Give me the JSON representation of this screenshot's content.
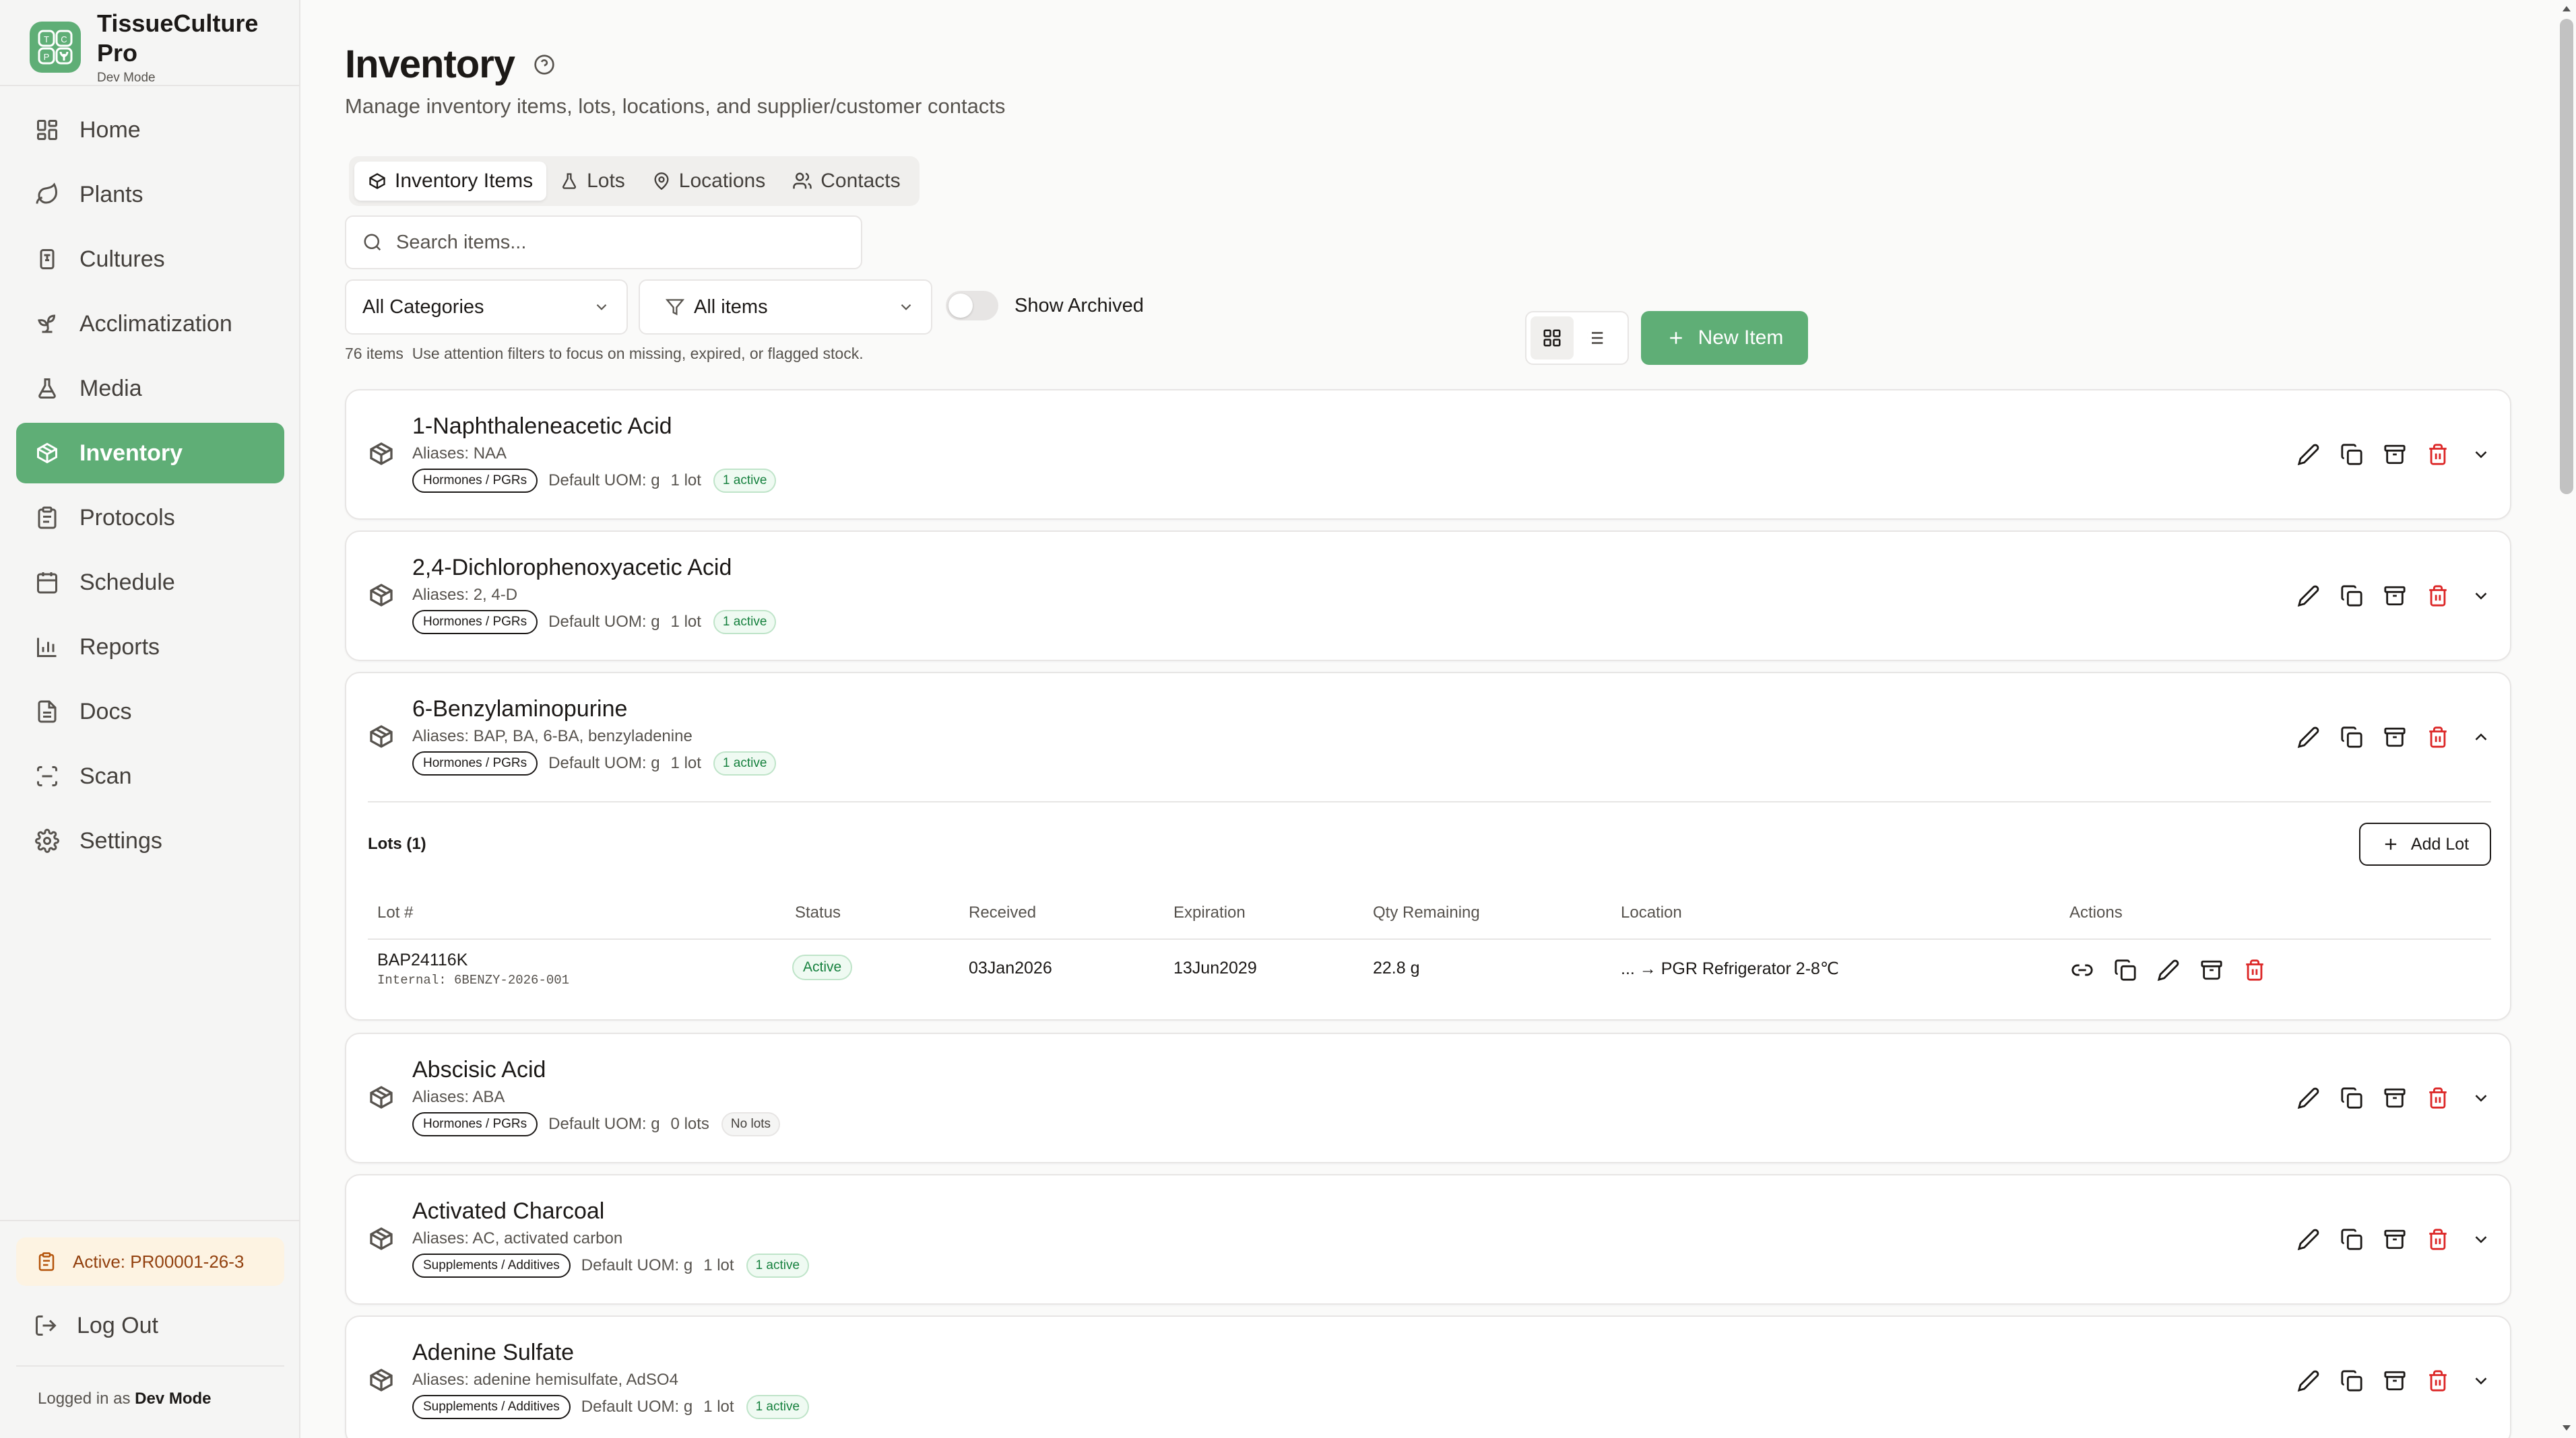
{
  "brand": {
    "name": "TissueCulture Pro",
    "mode": "Dev Mode"
  },
  "nav": [
    {
      "label": "Home",
      "icon": "home-icon",
      "active": false
    },
    {
      "label": "Plants",
      "icon": "leaf-icon",
      "active": false
    },
    {
      "label": "Cultures",
      "icon": "flask-icon",
      "active": false
    },
    {
      "label": "Acclimatization",
      "icon": "sprout-icon",
      "active": false
    },
    {
      "label": "Media",
      "icon": "beaker-icon",
      "active": false
    },
    {
      "label": "Inventory",
      "icon": "package-icon",
      "active": true
    },
    {
      "label": "Protocols",
      "icon": "clipboard-icon",
      "active": false
    },
    {
      "label": "Schedule",
      "icon": "calendar-icon",
      "active": false
    },
    {
      "label": "Reports",
      "icon": "bar-chart-icon",
      "active": false
    },
    {
      "label": "Docs",
      "icon": "document-icon",
      "active": false
    },
    {
      "label": "Scan",
      "icon": "scan-icon",
      "active": false
    },
    {
      "label": "Settings",
      "icon": "gear-icon",
      "active": false
    }
  ],
  "sidebar_footer": {
    "active_protocol": "Active: PR00001-26-3",
    "logout": "Log Out",
    "logged_in_prefix": "Logged in as",
    "logged_in_user": "Dev Mode"
  },
  "page": {
    "title": "Inventory",
    "subtitle": "Manage inventory items, lots, locations, and supplier/customer contacts"
  },
  "tabs": [
    {
      "label": "Inventory Items",
      "icon": "package-icon",
      "active": true
    },
    {
      "label": "Lots",
      "icon": "flask-icon",
      "active": false
    },
    {
      "label": "Locations",
      "icon": "map-pin-icon",
      "active": false
    },
    {
      "label": "Contacts",
      "icon": "users-icon",
      "active": false
    }
  ],
  "search": {
    "placeholder": "Search items...",
    "value": ""
  },
  "filters": {
    "category": "All Categories",
    "attention": "All items",
    "show_archived_label": "Show Archived",
    "show_archived": false
  },
  "counts": {
    "items": "76 items",
    "hint": "Use attention filters to focus on missing, expired, or flagged stock."
  },
  "view_mode": "grid",
  "new_item_label": "New Item",
  "items": [
    {
      "name": "1-Naphthaleneacetic Acid",
      "aliases": "Aliases: NAA",
      "category": "Hormones / PGRs",
      "uom": "Default UOM: g",
      "lots": "1 lot",
      "status": "1 active",
      "status_kind": "active",
      "expanded": false
    },
    {
      "name": "2,4-Dichlorophenoxyacetic Acid",
      "aliases": "Aliases: 2, 4-D",
      "category": "Hormones / PGRs",
      "uom": "Default UOM: g",
      "lots": "1 lot",
      "status": "1 active",
      "status_kind": "active",
      "expanded": false
    },
    {
      "name": "6-Benzylaminopurine",
      "aliases": "Aliases: BAP, BA, 6-BA, benzyladenine",
      "category": "Hormones / PGRs",
      "uom": "Default UOM: g",
      "lots": "1 lot",
      "status": "1 active",
      "status_kind": "active",
      "expanded": true
    },
    {
      "name": "Abscisic Acid",
      "aliases": "Aliases: ABA",
      "category": "Hormones / PGRs",
      "uom": "Default UOM: g",
      "lots": "0 lots",
      "status": "No lots",
      "status_kind": "none",
      "expanded": false
    },
    {
      "name": "Activated Charcoal",
      "aliases": "Aliases: AC, activated carbon",
      "category": "Supplements / Additives",
      "uom": "Default UOM: g",
      "lots": "1 lot",
      "status": "1 active",
      "status_kind": "active",
      "expanded": false
    },
    {
      "name": "Adenine Sulfate",
      "aliases": "Aliases: adenine hemisulfate, AdSO4",
      "category": "Supplements / Additives",
      "uom": "Default UOM: g",
      "lots": "1 lot",
      "status": "1 active",
      "status_kind": "active",
      "expanded": false
    }
  ],
  "lots_panel": {
    "title": "Lots (1)",
    "add_label": "Add Lot",
    "columns": [
      "Lot #",
      "Status",
      "Received",
      "Expiration",
      "Qty Remaining",
      "Location",
      "Actions"
    ],
    "rows": [
      {
        "lot": "BAP24116K",
        "internal": "Internal: 6BENZY-2026-001",
        "status": "Active",
        "received": "03Jan2026",
        "expiration": "13Jun2029",
        "qty": "22.8 g",
        "location": "... → PGR Refrigerator 2-8℃"
      }
    ]
  },
  "colors": {
    "accent": "#5fae76",
    "danger": "#dc2626",
    "active_pill_bg": "#fdf3e2",
    "active_pill_text": "#92400e"
  }
}
